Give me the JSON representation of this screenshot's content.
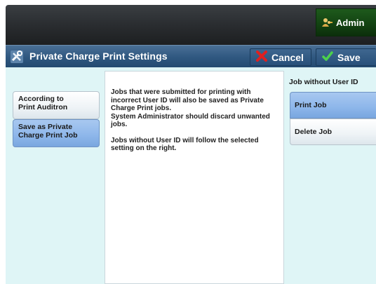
{
  "header": {
    "user_button_label": "Admin",
    "user_icon": "user-keys-icon"
  },
  "titlebar": {
    "title": "Private Charge Print Settings",
    "title_icon": "tools-icon",
    "cancel_label": "Cancel",
    "cancel_icon": "red-x-icon",
    "save_label": "Save",
    "save_icon": "green-check-icon"
  },
  "left_options": [
    {
      "label_line1": "According to",
      "label_line2": "Print Auditron",
      "selected": false
    },
    {
      "label_line1": "Save as Private",
      "label_line2": "Charge Print Job",
      "selected": true
    }
  ],
  "description": {
    "para1_line1": "Jobs that were submitted for printing with",
    "para1_line2": "incorrect User ID will also be saved as Private",
    "para1_line3": "Charge Print jobs.",
    "para1_line4": "System Administrator should discard unwanted",
    "para1_line5": "jobs.",
    "para2_line1": "Jobs without User ID will follow the selected",
    "para2_line2": "setting on the right."
  },
  "right_panel": {
    "heading": "Job without User ID",
    "options": [
      {
        "label": "Print Job",
        "selected": true
      },
      {
        "label": "Delete Job",
        "selected": false
      }
    ]
  },
  "colors": {
    "titlebar": "#2f5780",
    "content_bg": "#dff5f6",
    "selected_option": "#8db6ea",
    "admin_button": "#134312"
  }
}
